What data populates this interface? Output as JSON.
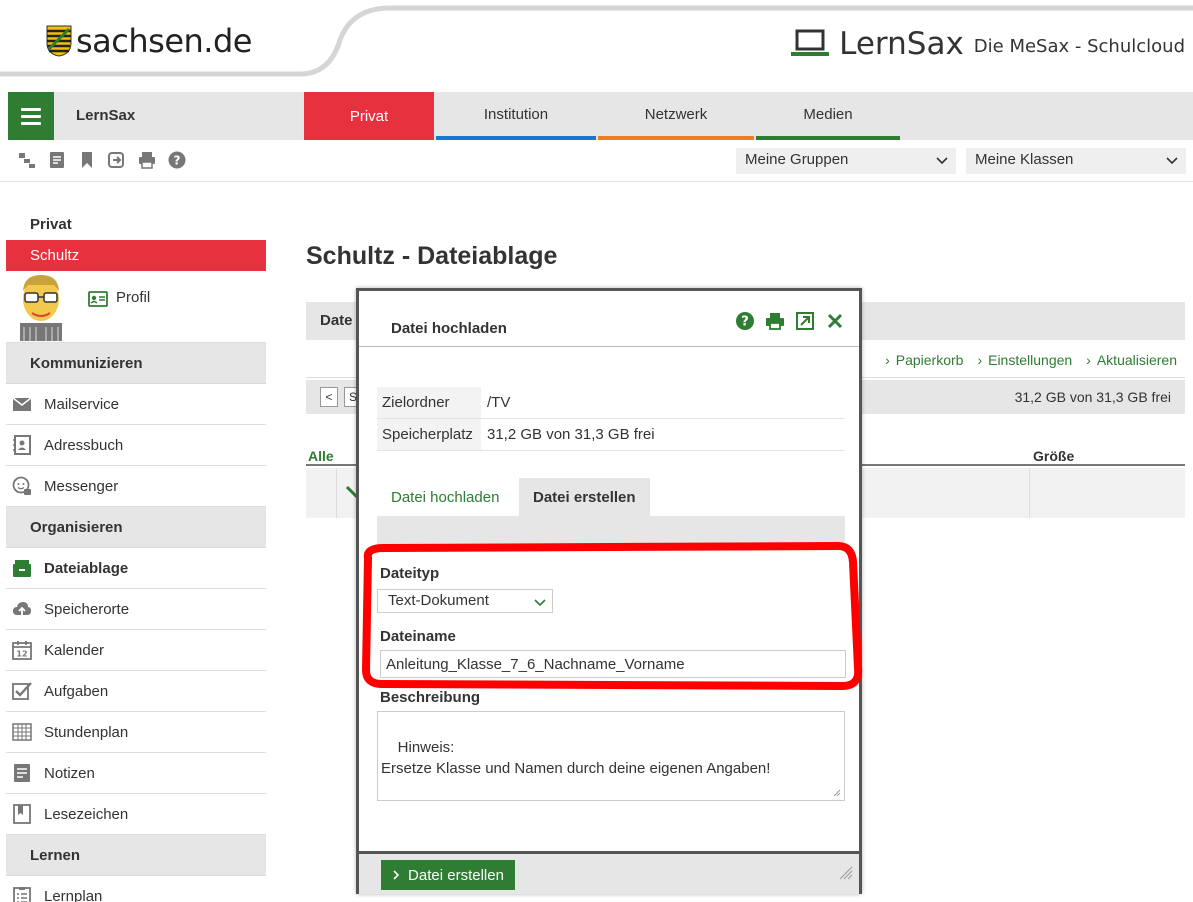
{
  "header": {
    "site_name": "sachsen.de",
    "brand": "LernSax",
    "tagline": "Die MeSax - Schulcloud"
  },
  "nav": {
    "label": "LernSax",
    "tabs": [
      "Privat",
      "Institution",
      "Netzwerk",
      "Medien"
    ]
  },
  "toolbar": {
    "groups_select": "Meine Gruppen",
    "classes_select": "Meine Klassen"
  },
  "sidebar": {
    "heading": "Privat",
    "active": "Schultz",
    "profile": "Profil",
    "sections": [
      {
        "title": "Kommunizieren",
        "items": [
          "Mailservice",
          "Adressbuch",
          "Messenger"
        ]
      },
      {
        "title": "Organisieren",
        "items": [
          "Dateiablage",
          "Speicherorte",
          "Kalender",
          "Aufgaben",
          "Stundenplan",
          "Notizen",
          "Lesezeichen"
        ]
      },
      {
        "title": "Lernen",
        "items": [
          "Lernplan"
        ]
      }
    ]
  },
  "main": {
    "title": "Schultz - Dateiablage",
    "bar_label": "Date",
    "crumbs": [
      "Papierkorb",
      "Einstellungen",
      "Aktualisieren"
    ],
    "pager_prev": "<",
    "pager_next": "S",
    "quota": "31,2 GB von 31,3 GB frei",
    "table": {
      "col_all": "Alle",
      "col_size": "Größe"
    }
  },
  "dialog": {
    "title": "Datei hochladen",
    "info": [
      {
        "key": "Zielordner",
        "value": "/TV"
      },
      {
        "key": "Speicherplatz",
        "value": "31,2 GB von 31,3 GB frei"
      }
    ],
    "tabs": [
      "Datei hochladen",
      "Datei erstellen"
    ],
    "filetype_label": "Dateityp",
    "filetype_value": "Text-Dokument",
    "filename_label": "Dateiname",
    "filename_value": "Anleitung_Klasse_7_6_Nachname_Vorname",
    "description_label": "Beschreibung",
    "description_value": "Hinweis:\nErsetze Klasse und Namen durch deine eigenen Angaben!",
    "submit": "Datei erstellen"
  },
  "colors": {
    "green": "#2e7d32",
    "red": "#e8313f",
    "blue": "#1976d2",
    "orange": "#ef7d22"
  }
}
